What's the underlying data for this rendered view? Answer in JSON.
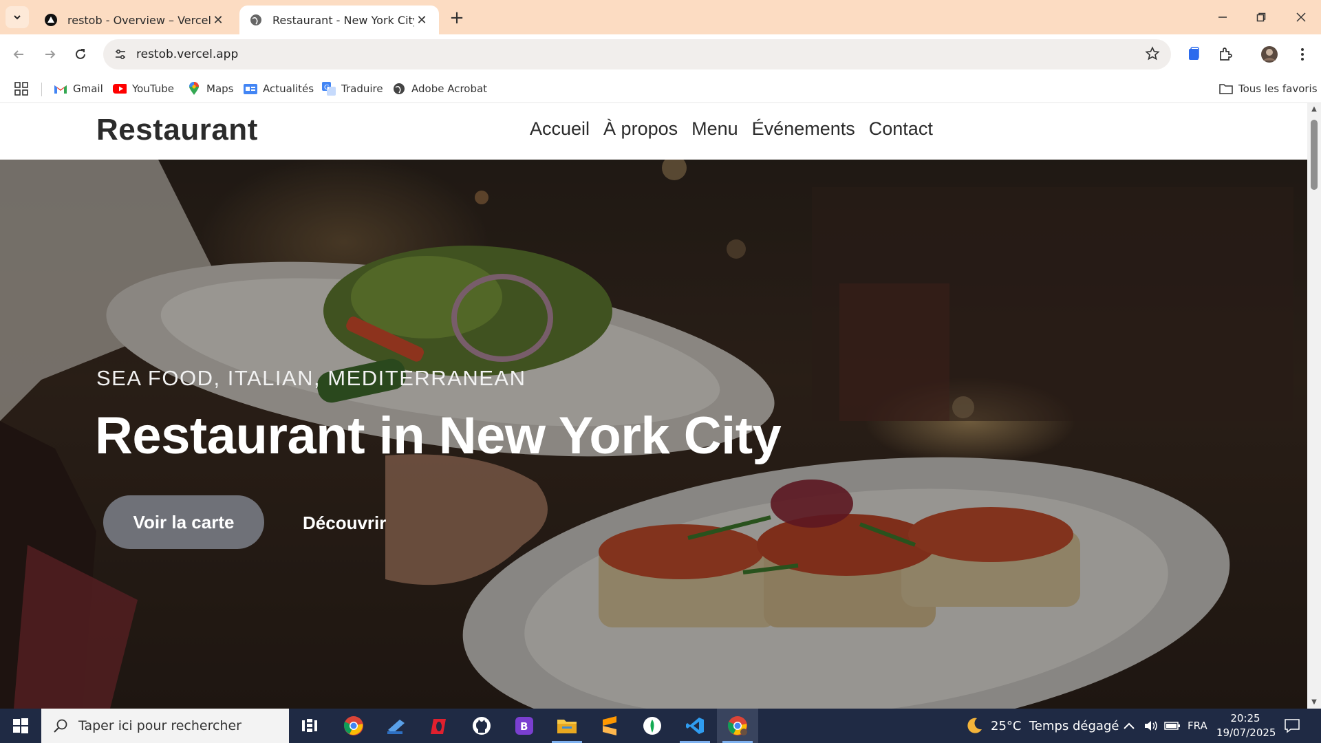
{
  "browser": {
    "tabs": [
      {
        "label": "restob - Overview – Vercel",
        "active": false
      },
      {
        "label": "Restaurant - New York City",
        "active": true
      }
    ],
    "url": "restob.vercel.app",
    "bookmarks": [
      {
        "label": "Gmail",
        "icon": "gmail-icon"
      },
      {
        "label": "YouTube",
        "icon": "youtube-icon"
      },
      {
        "label": "Maps",
        "icon": "maps-icon"
      },
      {
        "label": "Actualités",
        "icon": "news-icon"
      },
      {
        "label": "Traduire",
        "icon": "translate-icon"
      },
      {
        "label": "Adobe Acrobat",
        "icon": "globe-icon"
      }
    ],
    "all_bookmarks": "Tous les favoris"
  },
  "site": {
    "logo": "Restaurant",
    "nav": [
      "Accueil",
      "À propos",
      "Menu",
      "Événements",
      "Contact"
    ],
    "hero": {
      "subtitle": "SEA FOOD, ITALIAN, MEDITERRANEAN",
      "title": "Restaurant in New York City",
      "primary_button": "Voir la carte",
      "secondary_button": "Découvrir"
    }
  },
  "taskbar": {
    "search_placeholder": "Taper ici pour rechercher",
    "weather": "25°C  Temps dégagé",
    "language": "FRA",
    "time": "20:25",
    "date": "19/07/2025"
  },
  "colors": {
    "titlebar": "#fcdcc2",
    "primary_button": "#6f7178",
    "taskbar": "#1f2a44"
  }
}
